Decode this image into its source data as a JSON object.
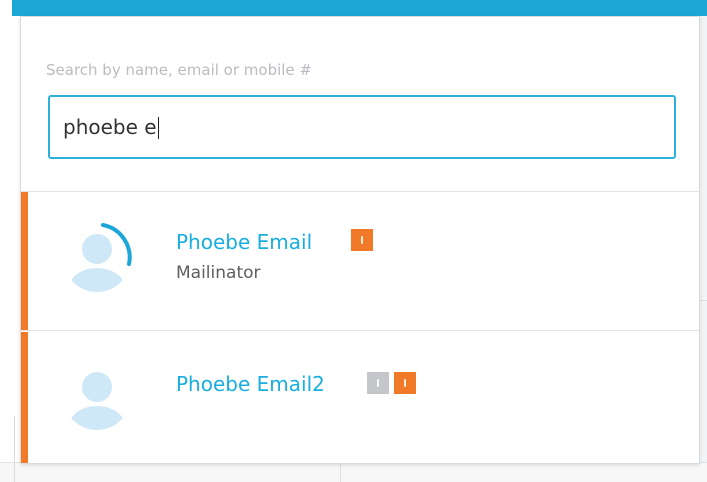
{
  "search": {
    "label": "Search by name, email or mobile #",
    "value": "phoebe e"
  },
  "results": [
    {
      "name": "Phoebe Email",
      "subtitle": "Mailinator",
      "badges": [
        "orange-status-badge"
      ]
    },
    {
      "name": "Phoebe Email2",
      "badges": [
        "gray-status-badge",
        "orange-status-badge"
      ]
    }
  ],
  "colors": {
    "accent": "#1ba8d9",
    "link": "#19aee0",
    "result_accent": "#f07a28",
    "badge_orange": "#f07a28",
    "badge_gray": "#c4c6c9",
    "avatar_fill": "#cfe8f8"
  }
}
